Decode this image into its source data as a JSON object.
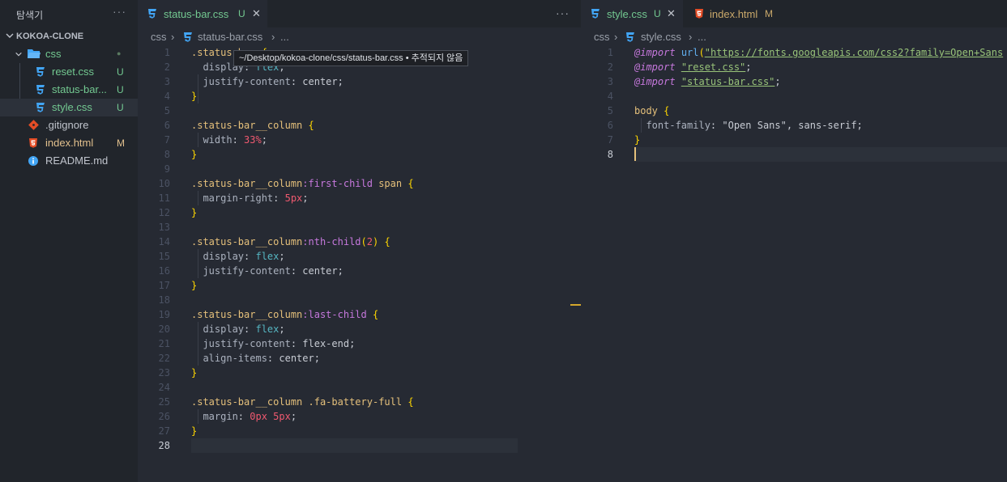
{
  "sidebar": {
    "title": "탐색기",
    "more": "···",
    "section": "KOKOA-CLONE",
    "items": [
      {
        "label": "css",
        "badge": "●",
        "type": "folder"
      },
      {
        "label": "reset.css",
        "badge": "U",
        "type": "css"
      },
      {
        "label": "status-bar...",
        "badge": "U",
        "type": "css"
      },
      {
        "label": "style.css",
        "badge": "U",
        "type": "css"
      },
      {
        "label": ".gitignore",
        "badge": "",
        "type": "git"
      },
      {
        "label": "index.html",
        "badge": "M",
        "type": "html"
      },
      {
        "label": "README.md",
        "badge": "",
        "type": "info"
      }
    ]
  },
  "left_editor": {
    "tab_label": "status-bar.css",
    "tab_status": "U",
    "tab_close": "✕",
    "more": "···",
    "crumbs": [
      "css",
      "›",
      "status-bar.css",
      "›",
      "..."
    ],
    "tooltip": "~/Desktop/kokoa-clone/css/status-bar.css • 추적되지 않음",
    "line_numbers": [
      "1",
      "2",
      "3",
      "4",
      "5",
      "6",
      "7",
      "8",
      "9",
      "10",
      "11",
      "12",
      "13",
      "14",
      "15",
      "16",
      "17",
      "18",
      "19",
      "20",
      "21",
      "22",
      "23",
      "24",
      "25",
      "26",
      "27",
      "28"
    ],
    "lines": [
      [
        [
          ".status-bar",
          "sel"
        ],
        [
          " {",
          "brace"
        ]
      ],
      [
        [
          "  display",
          "prop"
        ],
        [
          ": ",
          "val"
        ],
        [
          "flex",
          "kw"
        ],
        [
          ";",
          "val"
        ]
      ],
      [
        [
          "  justify-content",
          "prop"
        ],
        [
          ": ",
          "val"
        ],
        [
          "center",
          "val"
        ],
        [
          ";",
          "val"
        ]
      ],
      [
        [
          "}",
          "brace"
        ]
      ],
      [],
      [
        [
          ".status-bar__column",
          "sel"
        ],
        [
          " {",
          "brace"
        ]
      ],
      [
        [
          "  width",
          "prop"
        ],
        [
          ": ",
          "val"
        ],
        [
          "33%",
          "num"
        ],
        [
          ";",
          "val"
        ]
      ],
      [
        [
          "}",
          "brace"
        ]
      ],
      [],
      [
        [
          ".status-bar__column",
          "sel"
        ],
        [
          ":first-child",
          "pseudo"
        ],
        [
          " span",
          "sel"
        ],
        [
          " {",
          "brace"
        ]
      ],
      [
        [
          "  margin-right",
          "prop"
        ],
        [
          ": ",
          "val"
        ],
        [
          "5px",
          "num"
        ],
        [
          ";",
          "val"
        ]
      ],
      [
        [
          "}",
          "brace"
        ]
      ],
      [],
      [
        [
          ".status-bar__column",
          "sel"
        ],
        [
          ":nth-child",
          "pseudo"
        ],
        [
          "(",
          "brace"
        ],
        [
          "2",
          "num"
        ],
        [
          ")",
          "brace"
        ],
        [
          " {",
          "brace"
        ]
      ],
      [
        [
          "  display",
          "prop"
        ],
        [
          ": ",
          "val"
        ],
        [
          "flex",
          "kw"
        ],
        [
          ";",
          "val"
        ]
      ],
      [
        [
          "  justify-content",
          "prop"
        ],
        [
          ": ",
          "val"
        ],
        [
          "center",
          "val"
        ],
        [
          ";",
          "val"
        ]
      ],
      [
        [
          "}",
          "brace"
        ]
      ],
      [],
      [
        [
          ".status-bar__column",
          "sel"
        ],
        [
          ":last-child",
          "pseudo"
        ],
        [
          " {",
          "brace"
        ]
      ],
      [
        [
          "  display",
          "prop"
        ],
        [
          ": ",
          "val"
        ],
        [
          "flex",
          "kw"
        ],
        [
          ";",
          "val"
        ]
      ],
      [
        [
          "  justify-content",
          "prop"
        ],
        [
          ": ",
          "val"
        ],
        [
          "flex-end",
          "val"
        ],
        [
          ";",
          "val"
        ]
      ],
      [
        [
          "  align-items",
          "prop"
        ],
        [
          ": ",
          "val"
        ],
        [
          "center",
          "val"
        ],
        [
          ";",
          "val"
        ]
      ],
      [
        [
          "}",
          "brace"
        ]
      ],
      [],
      [
        [
          ".status-bar__column .fa-battery-full",
          "sel"
        ],
        [
          " {",
          "brace"
        ]
      ],
      [
        [
          "  margin",
          "prop"
        ],
        [
          ": ",
          "val"
        ],
        [
          "0px",
          "num"
        ],
        [
          " ",
          "val"
        ],
        [
          "5px",
          "num"
        ],
        [
          ";",
          "val"
        ]
      ],
      [
        [
          "}",
          "brace"
        ]
      ],
      []
    ],
    "current_line": 28
  },
  "right_editor": {
    "tabs": [
      {
        "label": "style.css",
        "status": "U",
        "close": "✕",
        "active": true
      },
      {
        "label": "index.html",
        "status": "M",
        "close": "",
        "active": false
      }
    ],
    "crumbs": [
      "css",
      "›",
      "style.css",
      "›",
      "..."
    ],
    "line_numbers": [
      "1",
      "2",
      "3",
      "4",
      "5",
      "6",
      "7",
      "8"
    ],
    "lines": [
      [
        [
          "@import",
          "at"
        ],
        [
          " ",
          "val"
        ],
        [
          "url",
          "fn"
        ],
        [
          "(",
          "brace"
        ],
        [
          "\"https://fonts.googleapis.com/css2?family=Open+Sans",
          "str"
        ]
      ],
      [
        [
          "@import",
          "at"
        ],
        [
          " ",
          "val"
        ],
        [
          "\"reset.css\"",
          "str"
        ],
        [
          ";",
          "val"
        ]
      ],
      [
        [
          "@import",
          "at"
        ],
        [
          " ",
          "val"
        ],
        [
          "\"status-bar.css\"",
          "str"
        ],
        [
          ";",
          "val"
        ]
      ],
      [],
      [
        [
          "body",
          "sel"
        ],
        [
          " {",
          "brace"
        ]
      ],
      [
        [
          "  font-family",
          "prop"
        ],
        [
          ": ",
          "val"
        ],
        [
          "\"Open Sans\"",
          "val"
        ],
        [
          ", sans-serif;",
          "val"
        ]
      ],
      [
        [
          "}",
          "brace"
        ]
      ],
      []
    ],
    "current_line": 8
  },
  "colors": {
    "css_icon": "#42a5f5",
    "html_icon": "#e44d26",
    "git_icon": "#e44d26",
    "untracked": "#73c991",
    "modified": "#e2c08d"
  }
}
